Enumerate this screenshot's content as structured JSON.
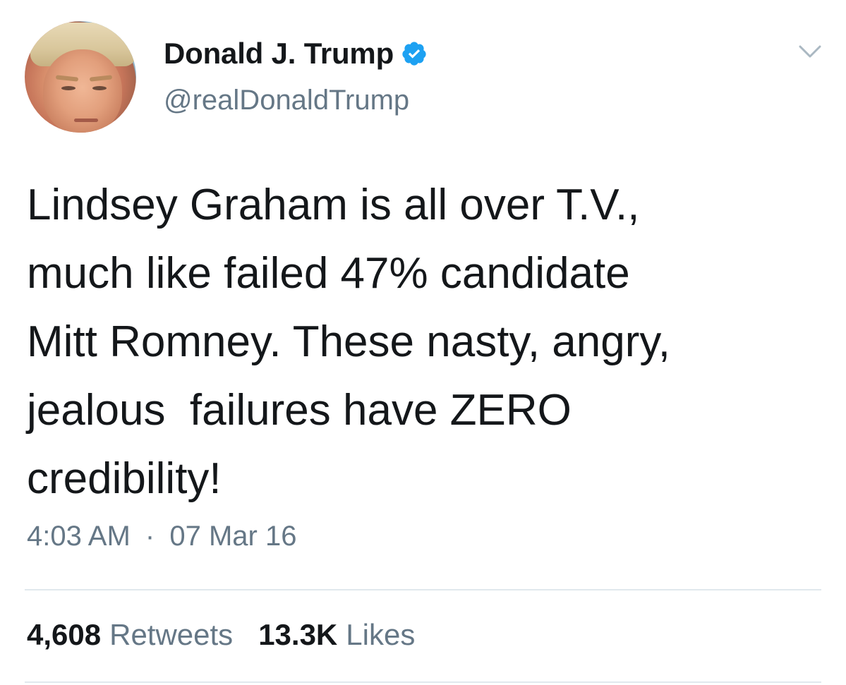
{
  "tweet": {
    "author": {
      "display_name": "Donald J. Trump",
      "handle": "@realDonaldTrump",
      "verified": true,
      "verified_icon": "verified-badge-icon"
    },
    "menu_icon": "chevron-down-icon",
    "text": "Lindsey Graham is all over T.V.,\nmuch like failed 47% candidate\nMitt Romney. These nasty, angry,\njealous  failures have ZERO\ncredibility!",
    "time": "4:03 AM",
    "separator": "·",
    "date": "07 Mar 16",
    "stats": {
      "retweets_count": "4,608",
      "retweets_label": "Retweets",
      "likes_count": "13.3K",
      "likes_label": "Likes"
    }
  },
  "colors": {
    "text_primary": "#14171a",
    "text_secondary": "#657786",
    "verified_blue": "#1da1f2",
    "divider": "#e1e8ed"
  }
}
